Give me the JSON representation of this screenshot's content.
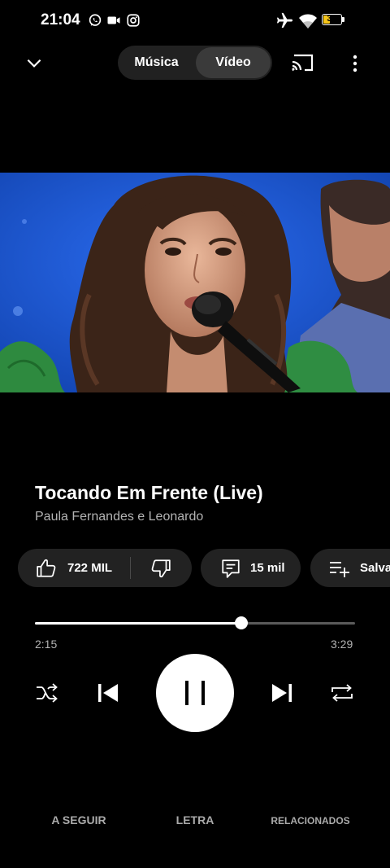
{
  "status_bar": {
    "time": "21:04",
    "battery_level": "39",
    "battery_fill": 0.39,
    "icons": [
      "whatsapp-icon",
      "video-camera-icon",
      "instagram-icon",
      "airplane-mode-icon",
      "wifi-icon",
      "battery-icon"
    ]
  },
  "top_bar": {
    "tabs": [
      {
        "label": "Música",
        "selected": false
      },
      {
        "label": "Vídeo",
        "selected": true
      }
    ],
    "icons": [
      "chevron-down-icon",
      "cast-icon",
      "more-vert-icon"
    ]
  },
  "song": {
    "title": "Tocando Em Frente (Live)",
    "artist": "Paula Fernandes e Leonardo"
  },
  "actions": {
    "like_count": "722 MIL",
    "comments_count": "15 mil",
    "save_label": "Salvar"
  },
  "player": {
    "current_time": "2:15",
    "total_time": "3:29",
    "progress": 0.645,
    "state": "playing"
  },
  "bottom_tabs": [
    "A SEGUIR",
    "LETRA",
    "RELACIONADOS"
  ],
  "colors": {
    "background": "#000000",
    "surface": "#222222",
    "secondary_text": "#b3b3b3",
    "battery": "#f5c518",
    "video_backdrop": "#1554c8"
  }
}
